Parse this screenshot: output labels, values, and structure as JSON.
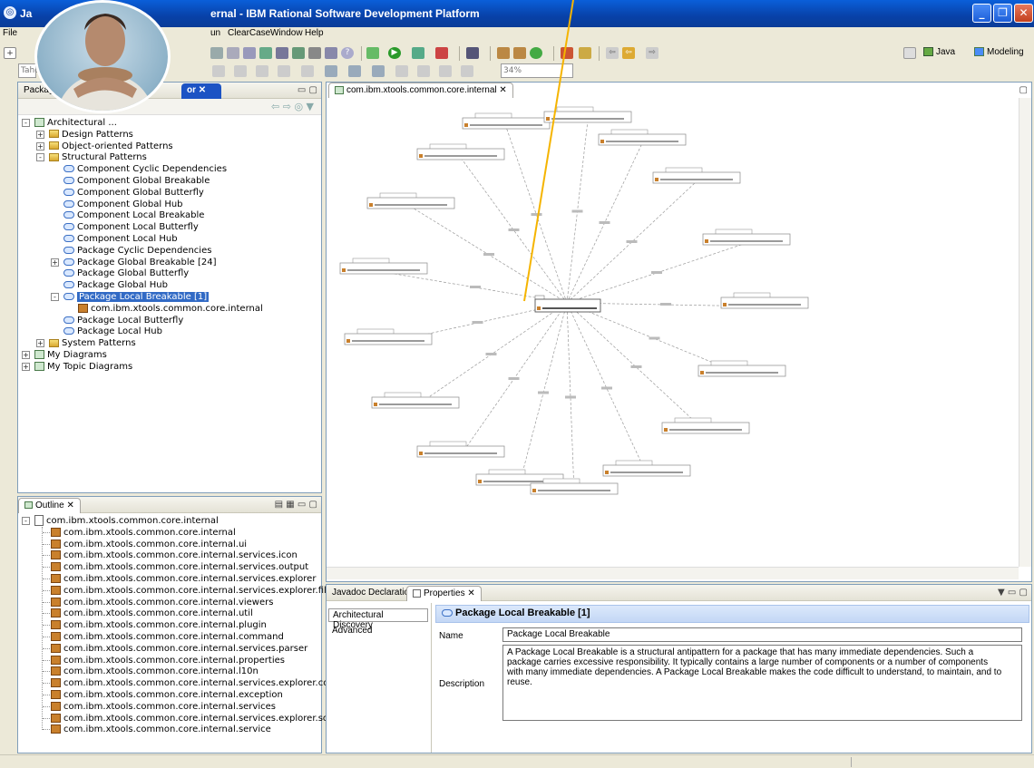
{
  "window": {
    "title_prefix": "Ja",
    "title": "ernal - IBM Rational Software Development Platform"
  },
  "menu": {
    "file": "File",
    "partial": "un",
    "clearcase": "ClearCase",
    "window": "Window",
    "help": "Help"
  },
  "toolbar": {
    "combo_left": "Tahoi",
    "zoom": "34%"
  },
  "perspectives": {
    "java": "Java",
    "modeling": "Modeling"
  },
  "left_panel": {
    "tab_left": "Package",
    "tab_right": "or",
    "tree": [
      {
        "label": "Architectural ...",
        "level": 0,
        "icon": "diagram",
        "exp": "-"
      },
      {
        "label": "Design Patterns",
        "level": 1,
        "icon": "folder",
        "exp": "+"
      },
      {
        "label": "Object-oriented Patterns",
        "level": 1,
        "icon": "folder",
        "exp": "+"
      },
      {
        "label": "Structural Patterns",
        "level": 1,
        "icon": "folder",
        "exp": "-"
      },
      {
        "label": "Component Cyclic Dependencies",
        "level": 2,
        "icon": "pattern",
        "exp": ""
      },
      {
        "label": "Component Global Breakable",
        "level": 2,
        "icon": "pattern",
        "exp": ""
      },
      {
        "label": "Component Global Butterfly",
        "level": 2,
        "icon": "pattern",
        "exp": ""
      },
      {
        "label": "Component Global Hub",
        "level": 2,
        "icon": "pattern",
        "exp": ""
      },
      {
        "label": "Component Local Breakable",
        "level": 2,
        "icon": "pattern",
        "exp": ""
      },
      {
        "label": "Component Local Butterfly",
        "level": 2,
        "icon": "pattern",
        "exp": ""
      },
      {
        "label": "Component Local Hub",
        "level": 2,
        "icon": "pattern",
        "exp": ""
      },
      {
        "label": "Package Cyclic Dependencies",
        "level": 2,
        "icon": "pattern",
        "exp": ""
      },
      {
        "label": "Package Global Breakable [24]",
        "level": 2,
        "icon": "pattern",
        "exp": "+"
      },
      {
        "label": "Package Global Butterfly",
        "level": 2,
        "icon": "pattern",
        "exp": ""
      },
      {
        "label": "Package Global Hub",
        "level": 2,
        "icon": "pattern",
        "exp": ""
      },
      {
        "label": "Package Local Breakable [1]",
        "level": 2,
        "icon": "pattern",
        "exp": "-",
        "selected": true
      },
      {
        "label": "com.ibm.xtools.common.core.internal",
        "level": 3,
        "icon": "pkg",
        "exp": ""
      },
      {
        "label": "Package Local Butterfly",
        "level": 2,
        "icon": "pattern",
        "exp": ""
      },
      {
        "label": "Package Local Hub",
        "level": 2,
        "icon": "pattern",
        "exp": ""
      },
      {
        "label": "System Patterns",
        "level": 1,
        "icon": "folder",
        "exp": "+"
      },
      {
        "label": "My Diagrams",
        "level": 0,
        "icon": "diagram",
        "exp": "+"
      },
      {
        "label": "My Topic Diagrams",
        "level": 0,
        "icon": "diagram",
        "exp": "+"
      }
    ]
  },
  "outline": {
    "tab": "Outline",
    "root": "com.ibm.xtools.common.core.internal",
    "items": [
      "com.ibm.xtools.common.core.internal",
      "com.ibm.xtools.common.core.internal.ui",
      "com.ibm.xtools.common.core.internal.services.icon",
      "com.ibm.xtools.common.core.internal.services.output",
      "com.ibm.xtools.common.core.internal.services.explorer",
      "com.ibm.xtools.common.core.internal.services.explorer.filtering",
      "com.ibm.xtools.common.core.internal.viewers",
      "com.ibm.xtools.common.core.internal.util",
      "com.ibm.xtools.common.core.internal.plugin",
      "com.ibm.xtools.common.core.internal.command",
      "com.ibm.xtools.common.core.internal.services.parser",
      "com.ibm.xtools.common.core.internal.properties",
      "com.ibm.xtools.common.core.internal.l10n",
      "com.ibm.xtools.common.core.internal.services.explorer.content",
      "com.ibm.xtools.common.core.internal.exception",
      "com.ibm.xtools.common.core.internal.services",
      "com.ibm.xtools.common.core.internal.services.explorer.sorting",
      "com.ibm.xtools.common.core.internal.service"
    ]
  },
  "editor": {
    "tab": "com.ibm.xtools.common.core.internal"
  },
  "bottom_tabs": {
    "javadoc": "Javadoc",
    "declaration": "Declaration",
    "properties": "Properties"
  },
  "properties": {
    "sidebar_tabs": [
      "Architectural Discovery",
      "Advanced"
    ],
    "header": "Package Local Breakable [1]",
    "name_label": "Name",
    "name_value": "Package Local Breakable",
    "description_label": "Description",
    "description_value": "A Package Local Breakable is a structural antipattern for a package that has many immediate dependencies. Such a package carries excessive responsibility. It typically contains a large number of components or a number of components with many immediate dependencies. A Package Local Breakable makes the code difficult to understand, to maintain, and to reuse."
  },
  "colors": {
    "titlebar": "#0a3c98",
    "selection": "#316ac5",
    "panel_border": "#7f9db9",
    "annotation_line": "#f5b400"
  }
}
